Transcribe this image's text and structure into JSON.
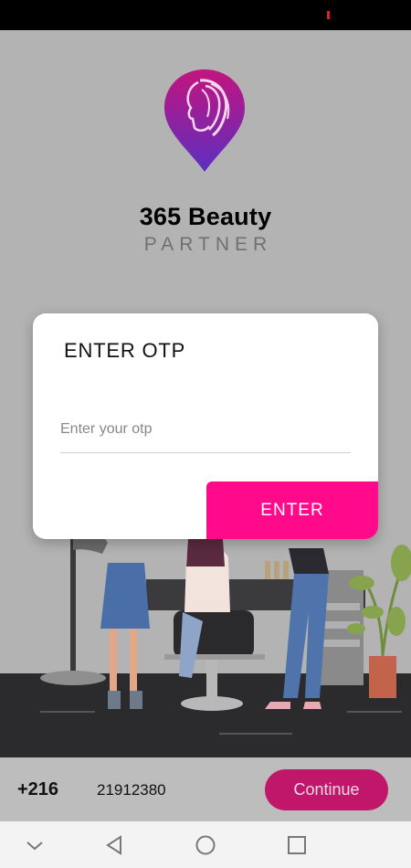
{
  "brand": {
    "title": "365 Beauty",
    "subtitle": "PARTNER"
  },
  "dialog": {
    "title": "ENTER OTP",
    "input_placeholder": "Enter your otp",
    "input_value": "",
    "enter_label": "ENTER"
  },
  "login": {
    "country_code": "+216",
    "phone_number": "21912380",
    "continue_label": "Continue"
  },
  "nav": {
    "icons": [
      "chevron-down-icon",
      "back-icon",
      "home-icon",
      "recents-icon"
    ]
  },
  "colors": {
    "accent": "#ff0a8a",
    "continue_button": "#c0176a",
    "logo_top": "#c3147e",
    "logo_bottom": "#5b2fc0",
    "background": "#b3b3b3"
  }
}
